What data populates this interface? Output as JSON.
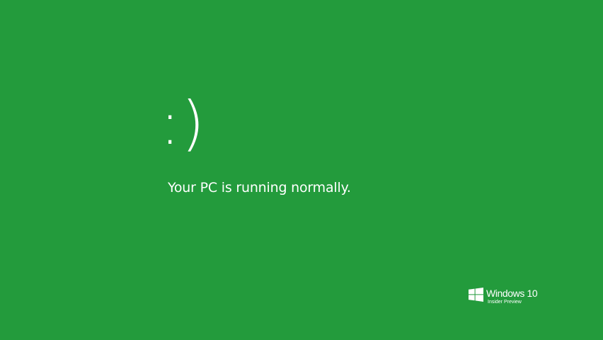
{
  "screen": {
    "background_color": "#239b3c",
    "text_color": "#ffffff",
    "face": ":)",
    "message": "Your PC is running normally."
  },
  "brand": {
    "logo_icon": "windows-logo-icon",
    "name": "Windows 10",
    "edition": "Insider Preview"
  }
}
